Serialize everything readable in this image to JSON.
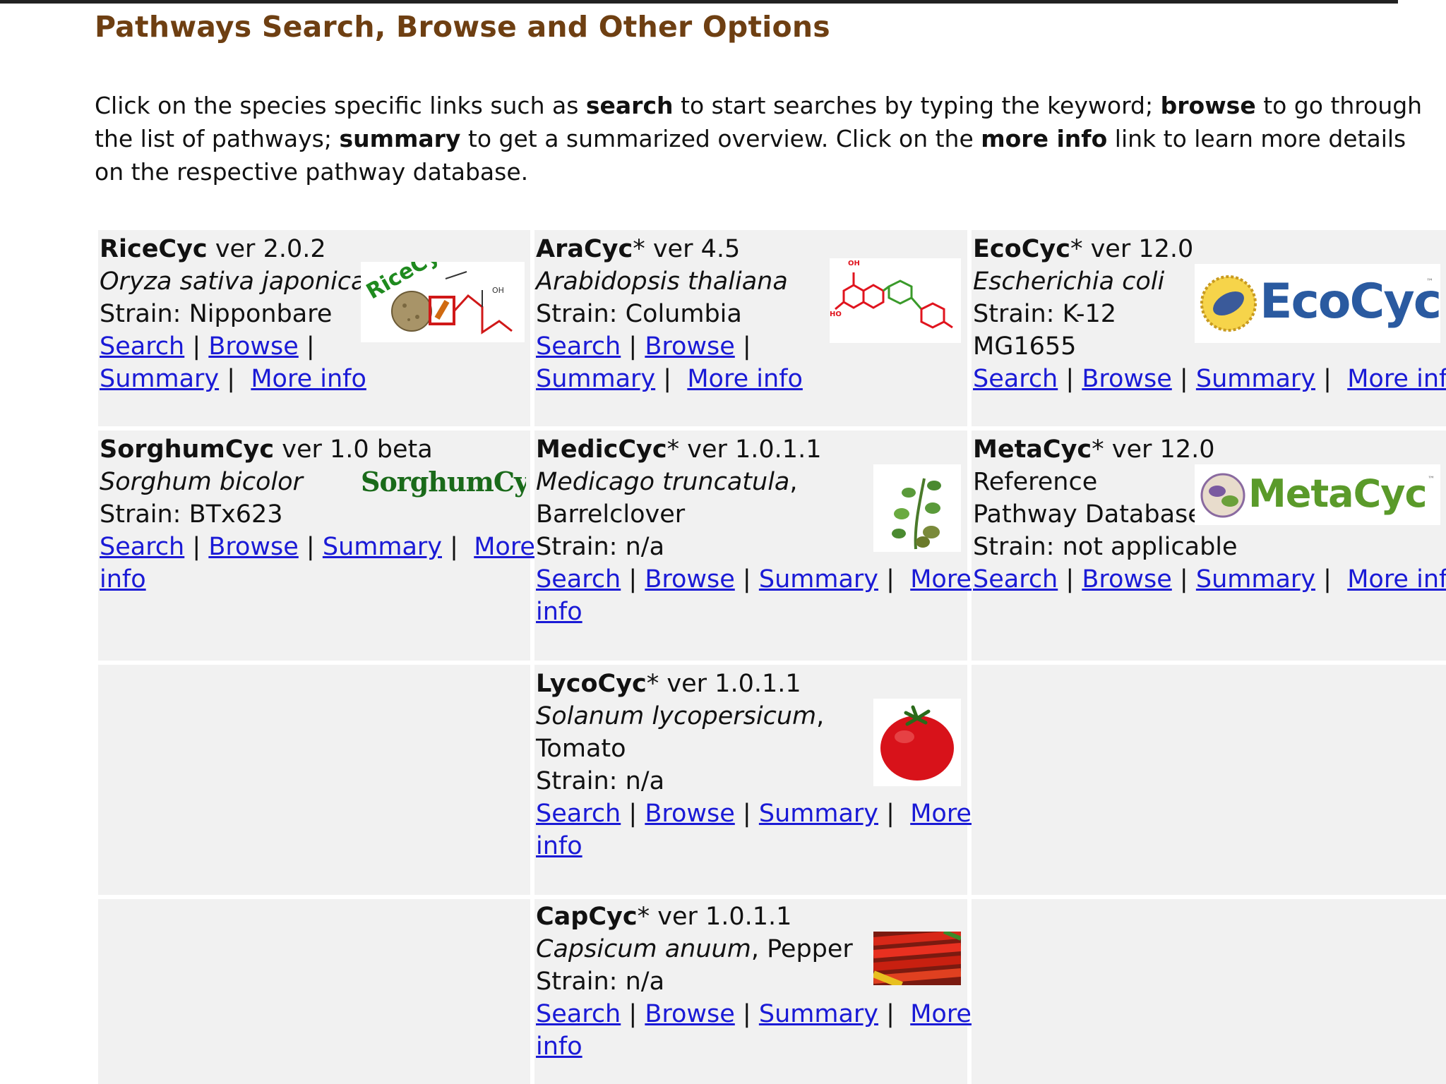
{
  "header": {
    "title": "Pathways Search, Browse and Other Options"
  },
  "intro": {
    "p1": "Click on the species specific links such as ",
    "b1": "search",
    "p2": " to start searches by typing the keyword; ",
    "b2": "browse",
    "p3": " to go through the list of pathways; ",
    "b3": "summary",
    "p4": " to get a summarized overview. Click on the ",
    "b4": "more info",
    "p5": " link to learn more details on the respective pathway database."
  },
  "links": {
    "search": "Search",
    "browse": "Browse",
    "summary": "Summary",
    "more_info": "More info",
    "more": "More",
    "info": "info",
    "sep": "|"
  },
  "cells": {
    "ricecyc": {
      "name": "RiceCyc",
      "version": " ver 2.0.2",
      "species": "Oryza sativa japonica",
      "strain": "Strain: Nipponbare",
      "logo_text": "RiceCyc",
      "logo_oh": "OH"
    },
    "aracyc": {
      "name": "AraCyc",
      "star": "*",
      "version": " ver 4.5",
      "species": "Arabidopsis thaliana",
      "strain": "Strain: Columbia",
      "logo_oh": "OH",
      "logo_ho": "HO"
    },
    "ecocyc": {
      "name": "EcoCyc",
      "star": "*",
      "version": " ver 12.0",
      "species": "Escherichia coli",
      "strain": "Strain: K-12",
      "strain2": "MG1655",
      "logo_text": "EcoCyc",
      "logo_tm": "™"
    },
    "sorghumcyc": {
      "name": "SorghumCyc",
      "version": " ver 1.0 beta",
      "species": "Sorghum bicolor",
      "strain": "Strain: BTx623",
      "logo_text": "SorghumCyc"
    },
    "mediccyc": {
      "name": "MedicCyc",
      "star": "*",
      "version": " ver 1.0.1.1",
      "species": "Medicago truncatula",
      "common": ",",
      "common2": "Barrelclover",
      "strain": "Strain: n/a"
    },
    "metacyc": {
      "name": "MetaCyc",
      "star": "*",
      "version": " ver 12.0",
      "line2": "Reference",
      "line3": "Pathway Database",
      "strain": "Strain: not applicable",
      "logo_text": "MetaCyc",
      "logo_tm": "™"
    },
    "lycocyc": {
      "name": "LycoCyc",
      "star": "*",
      "version": " ver 1.0.1.1",
      "species": "Solanum lycopersicum",
      "common": ",",
      "common2": "Tomato",
      "strain": "Strain: n/a"
    },
    "capcyc": {
      "name": "CapCyc",
      "star": "*",
      "version": " ver 1.0.1.1",
      "species": "Capsicum anuum",
      "common": ", Pepper",
      "strain": "Strain: n/a"
    }
  },
  "colors": {
    "title": "#6e3f12",
    "link": "#1a1ad6",
    "cell_bg": "#f1f1f1"
  },
  "icons": {
    "ricecyc_logo": "ricecyc-logo",
    "aracyc_logo": "flavonoid-molecule-logo",
    "ecocyc_logo": "ecocyc-logo",
    "sorghumcyc_logo": "sorghumcyc-logo",
    "mediccyc_logo": "medicago-plant-image",
    "metacyc_logo": "metacyc-logo",
    "lycocyc_logo": "tomato-image",
    "capcyc_logo": "peppers-image"
  }
}
